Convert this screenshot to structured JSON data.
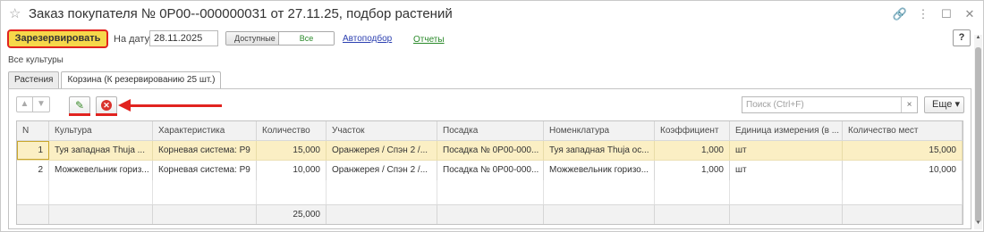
{
  "window": {
    "title": "Заказ покупателя № 0Р00--000000031 от 27.11.25, подбор растений",
    "icons": [
      "star-icon",
      "link-icon",
      "more-icon",
      "maximize-icon",
      "close-icon"
    ]
  },
  "toolbar": {
    "reserve_label": "Зарезервировать",
    "date_label": "На дату:",
    "date_value": "28.11.2025",
    "filter_options": [
      "Доступные",
      "Все"
    ],
    "filter_selected": "Все",
    "auto_select_link": "Автоподбор",
    "reports_link": "Отчеты",
    "help_label": "?"
  },
  "filter_text": "Все культуры",
  "tabs": [
    {
      "label": "Растения",
      "active": false
    },
    {
      "label": "Корзина (К резервированию 25 шт.)",
      "active": true
    }
  ],
  "table_toolbar": {
    "search_placeholder": "Поиск (Ctrl+F)",
    "more_label": "Еще ▾",
    "accent_color": "#e1231f"
  },
  "table": {
    "columns": [
      "N",
      "Культура",
      "Характеристика",
      "Количество",
      "Участок",
      "Посадка",
      "Номенклатура",
      "Коэффициент",
      "Единица измерения (в ...",
      "Количество мест"
    ],
    "rows": [
      [
        "1",
        "Туя западная Thuja ...",
        "Корневая система: Р9",
        "15,000",
        "Оранжерея / Спэн 2 /...",
        "Посадка № 0Р00-000...",
        "Туя западная Thuja ос...",
        "1,000",
        "шт",
        "15,000"
      ],
      [
        "2",
        "Можжевельник гориз...",
        "Корневая система: Р9",
        "10,000",
        "Оранжерея / Спэн 2 /...",
        "Посадка № 0Р00-000...",
        "Можжевельник горизо...",
        "1,000",
        "шт",
        "10,000"
      ]
    ],
    "footer_total_qty": "25,000",
    "selected_row_color": "#fbefc4"
  }
}
